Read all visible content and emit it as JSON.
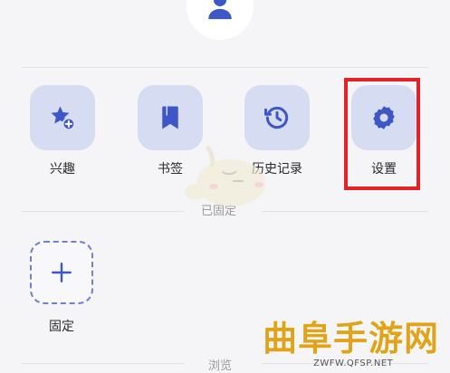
{
  "shortcuts": [
    {
      "label": "兴趣",
      "icon": "star-plus-icon"
    },
    {
      "label": "书签",
      "icon": "bookmark-icon"
    },
    {
      "label": "历史记录",
      "icon": "history-icon"
    },
    {
      "label": "设置",
      "icon": "gear-icon"
    }
  ],
  "pinned_section": {
    "title": "已固定",
    "add_label": "固定"
  },
  "browse_section": {
    "title": "浏览"
  },
  "colors": {
    "accent": "#3d56c8",
    "tile_background": "#d6dcf2",
    "highlight": "#e52128",
    "background": "#f5f5f7"
  },
  "watermark": {
    "brand": "曲阜手游网",
    "url": "ZWFW.QFSP.NET"
  }
}
